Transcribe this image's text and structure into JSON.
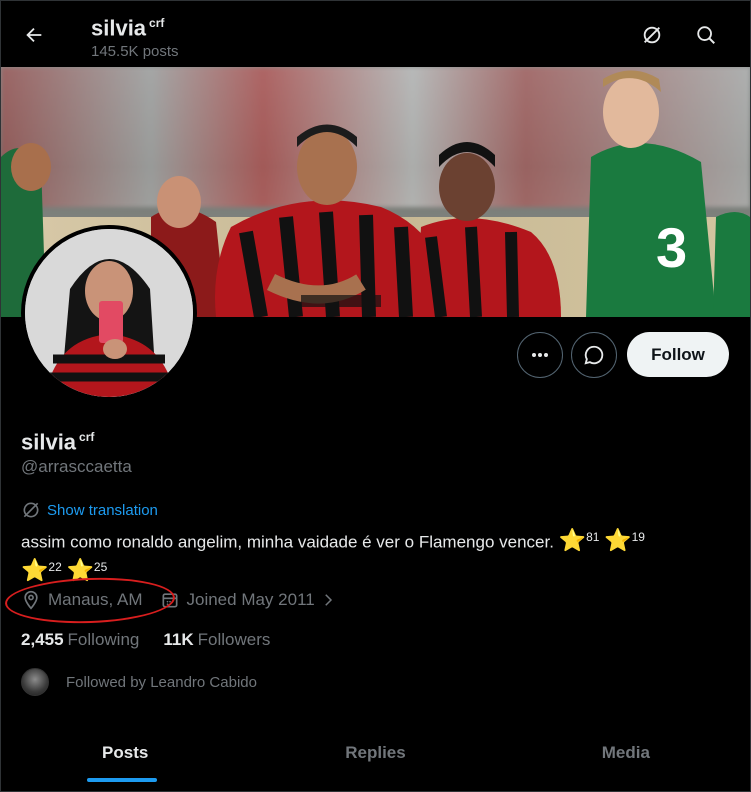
{
  "header": {
    "name": "silvia",
    "name_sup": "crf",
    "posts_count": "145.5K posts"
  },
  "profile": {
    "name": "silvia",
    "name_sup": "crf",
    "handle": "@arrasccaetta",
    "show_translation": "Show translation",
    "bio_text": "assim como ronaldo angelim, minha vaidade é ver o Flamengo vencer.",
    "bio_stars": [
      {
        "star": "⭐",
        "num": "81"
      },
      {
        "star": "⭐",
        "num": "19"
      },
      {
        "star": "⭐",
        "num": "22"
      },
      {
        "star": "⭐",
        "num": "25"
      }
    ],
    "location": "Manaus, AM",
    "joined": "Joined May 2011",
    "following_count": "2,455",
    "following_label": "Following",
    "followers_count": "11K",
    "followers_label": "Followers",
    "followed_by": "Followed by Leandro Cabido"
  },
  "actions": {
    "follow_label": "Follow"
  },
  "tabs": [
    {
      "label": "Posts",
      "active": true
    },
    {
      "label": "Replies",
      "active": false
    },
    {
      "label": "Media",
      "active": false
    }
  ],
  "colors": {
    "accent": "#1d9bf0",
    "highlight_circle": "#d81e1e",
    "star": "#f5b00c"
  }
}
